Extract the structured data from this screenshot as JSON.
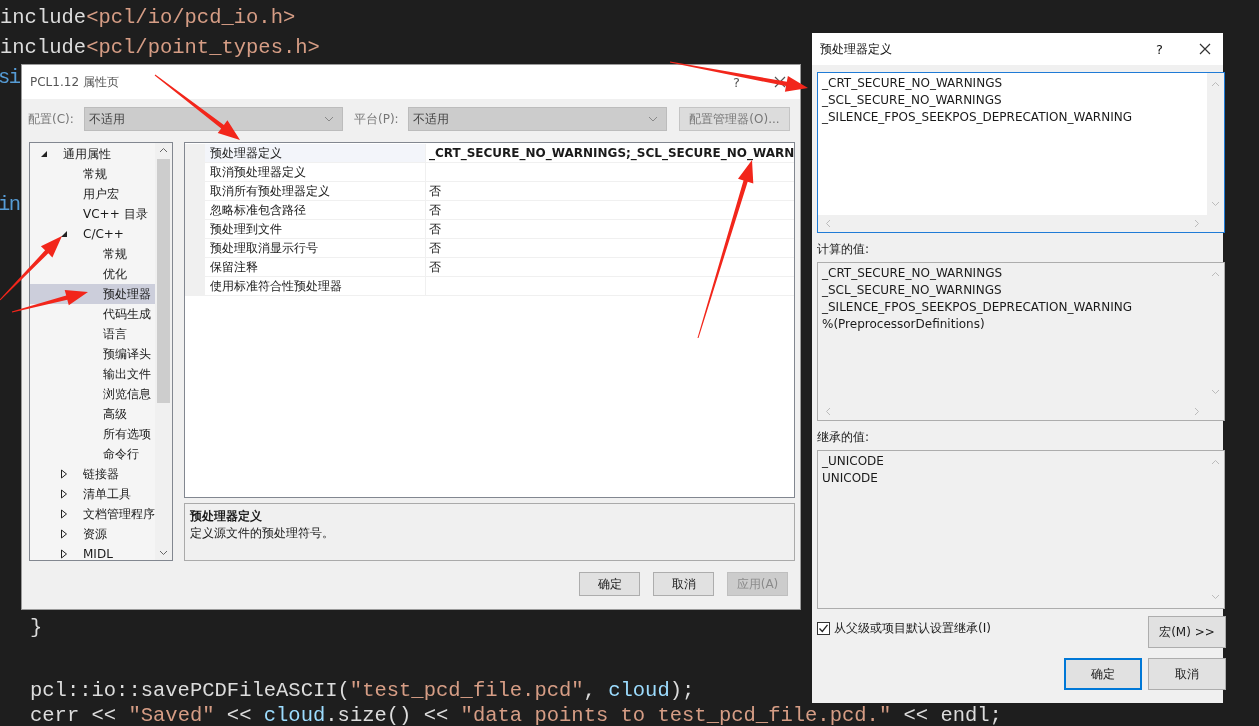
{
  "editor": {
    "lines": [
      {
        "tokens": [
          {
            "text": "include",
            "kind": "text"
          },
          {
            "text": "<pcl/io/pcd_io.h>",
            "kind": "string"
          }
        ]
      },
      {
        "tokens": [
          {
            "text": "include",
            "kind": "text"
          },
          {
            "text": "<pcl/point_types.h>",
            "kind": "string"
          }
        ]
      },
      {
        "tokens": [
          {
            "text": "si",
            "kind": "keyword"
          }
        ]
      },
      {
        "tokens": [
          {
            "text": "in",
            "kind": "keyword"
          }
        ]
      },
      {
        "tokens": [
          {
            "text": "}",
            "kind": "text"
          }
        ]
      },
      {
        "tokens": [
          {
            "text": "pcl::io::savePCDFileASCII(",
            "kind": "text"
          },
          {
            "text": "\"test_pcd_file.pcd\"",
            "kind": "string"
          },
          {
            "text": ", ",
            "kind": "text"
          },
          {
            "text": "cloud",
            "kind": "ident"
          },
          {
            "text": ");",
            "kind": "text"
          }
        ]
      },
      {
        "tokens": [
          {
            "text": "cerr << ",
            "kind": "text"
          },
          {
            "text": "\"Saved\"",
            "kind": "string"
          },
          {
            "text": " << ",
            "kind": "text"
          },
          {
            "text": "cloud",
            "kind": "ident"
          },
          {
            "text": ".size() << ",
            "kind": "text"
          },
          {
            "text": "\"data points to test_pcd_file.pcd.\"",
            "kind": "string"
          },
          {
            "text": " << endl;",
            "kind": "text"
          }
        ]
      }
    ]
  },
  "properties_dialog": {
    "title": "PCL1.12 属性页",
    "help": "?",
    "configuration": {
      "label": "配置(C):",
      "value": "不适用"
    },
    "platform": {
      "label": "平台(P):",
      "value": "不适用"
    },
    "config_manager_button": "配置管理器(O)...",
    "tree": {
      "items": [
        {
          "label": "通用属性",
          "expanded": true,
          "selected": false,
          "children": [
            {
              "label": "常规",
              "selected": false
            },
            {
              "label": "用户宏",
              "selected": false
            },
            {
              "label": "VC++ 目录",
              "selected": false
            },
            {
              "label": "C/C++",
              "expanded": true,
              "selected": false,
              "children": [
                {
                  "label": "常规",
                  "selected": false
                },
                {
                  "label": "优化",
                  "selected": false
                },
                {
                  "label": "预处理器",
                  "selected": true
                },
                {
                  "label": "代码生成",
                  "selected": false
                },
                {
                  "label": "语言",
                  "selected": false
                },
                {
                  "label": "预编译头",
                  "selected": false
                },
                {
                  "label": "输出文件",
                  "selected": false
                },
                {
                  "label": "浏览信息",
                  "selected": false
                },
                {
                  "label": "高级",
                  "selected": false
                },
                {
                  "label": "所有选项",
                  "selected": false
                },
                {
                  "label": "命令行",
                  "selected": false
                }
              ]
            },
            {
              "label": "链接器",
              "expanded": false,
              "selected": false
            },
            {
              "label": "清单工具",
              "expanded": false,
              "selected": false
            },
            {
              "label": "文档管理程序",
              "expanded": false,
              "selected": false
            },
            {
              "label": "资源",
              "expanded": false,
              "selected": false
            },
            {
              "label": "MIDL",
              "expanded": false,
              "selected": false
            }
          ]
        }
      ]
    },
    "properties": [
      {
        "name": "预处理器定义",
        "value": "_CRT_SECURE_NO_WARNINGS;_SCL_SECURE_NO_WARN",
        "selected": true
      },
      {
        "name": "取消预处理器定义",
        "selected": false
      },
      {
        "name": "取消所有预处理器定义",
        "value": "否",
        "selected": false
      },
      {
        "name": "忽略标准包含路径",
        "value": "否",
        "selected": false
      },
      {
        "name": "预处理到文件",
        "value": "否",
        "selected": false
      },
      {
        "name": "预处理取消显示行号",
        "value": "否",
        "selected": false
      },
      {
        "name": "保留注释",
        "value": "否",
        "selected": false
      },
      {
        "name": "使用标准符合性预处理器",
        "selected": false
      }
    ],
    "description": {
      "title": "预处理器定义",
      "text": "定义源文件的预处理符号。"
    },
    "buttons": [
      {
        "label": "确定",
        "disabled": false
      },
      {
        "label": "取消",
        "disabled": false
      },
      {
        "label": "应用(A)",
        "disabled": true
      }
    ]
  },
  "definitions_dialog": {
    "title": "预处理器定义",
    "help": "?",
    "value_lines": [
      "_CRT_SECURE_NO_WARNINGS",
      "_SCL_SECURE_NO_WARNINGS",
      "_SILENCE_FPOS_SEEKPOS_DEPRECATION_WARNING"
    ],
    "computed_label": "计算的值:",
    "computed_lines": [
      "_CRT_SECURE_NO_WARNINGS",
      "_SCL_SECURE_NO_WARNINGS",
      "_SILENCE_FPOS_SEEKPOS_DEPRECATION_WARNING",
      "%(PreprocessorDefinitions)"
    ],
    "inherited_label": "继承的值:",
    "inherited_lines": [
      "_UNICODE",
      "UNICODE"
    ],
    "inherit_checkbox": {
      "label": "从父级或项目默认设置继承(I)",
      "checked": true
    },
    "macros_button": "宏(M) >>",
    "buttons": [
      {
        "label": "确定",
        "default": true
      },
      {
        "label": "取消",
        "default": false
      }
    ]
  }
}
